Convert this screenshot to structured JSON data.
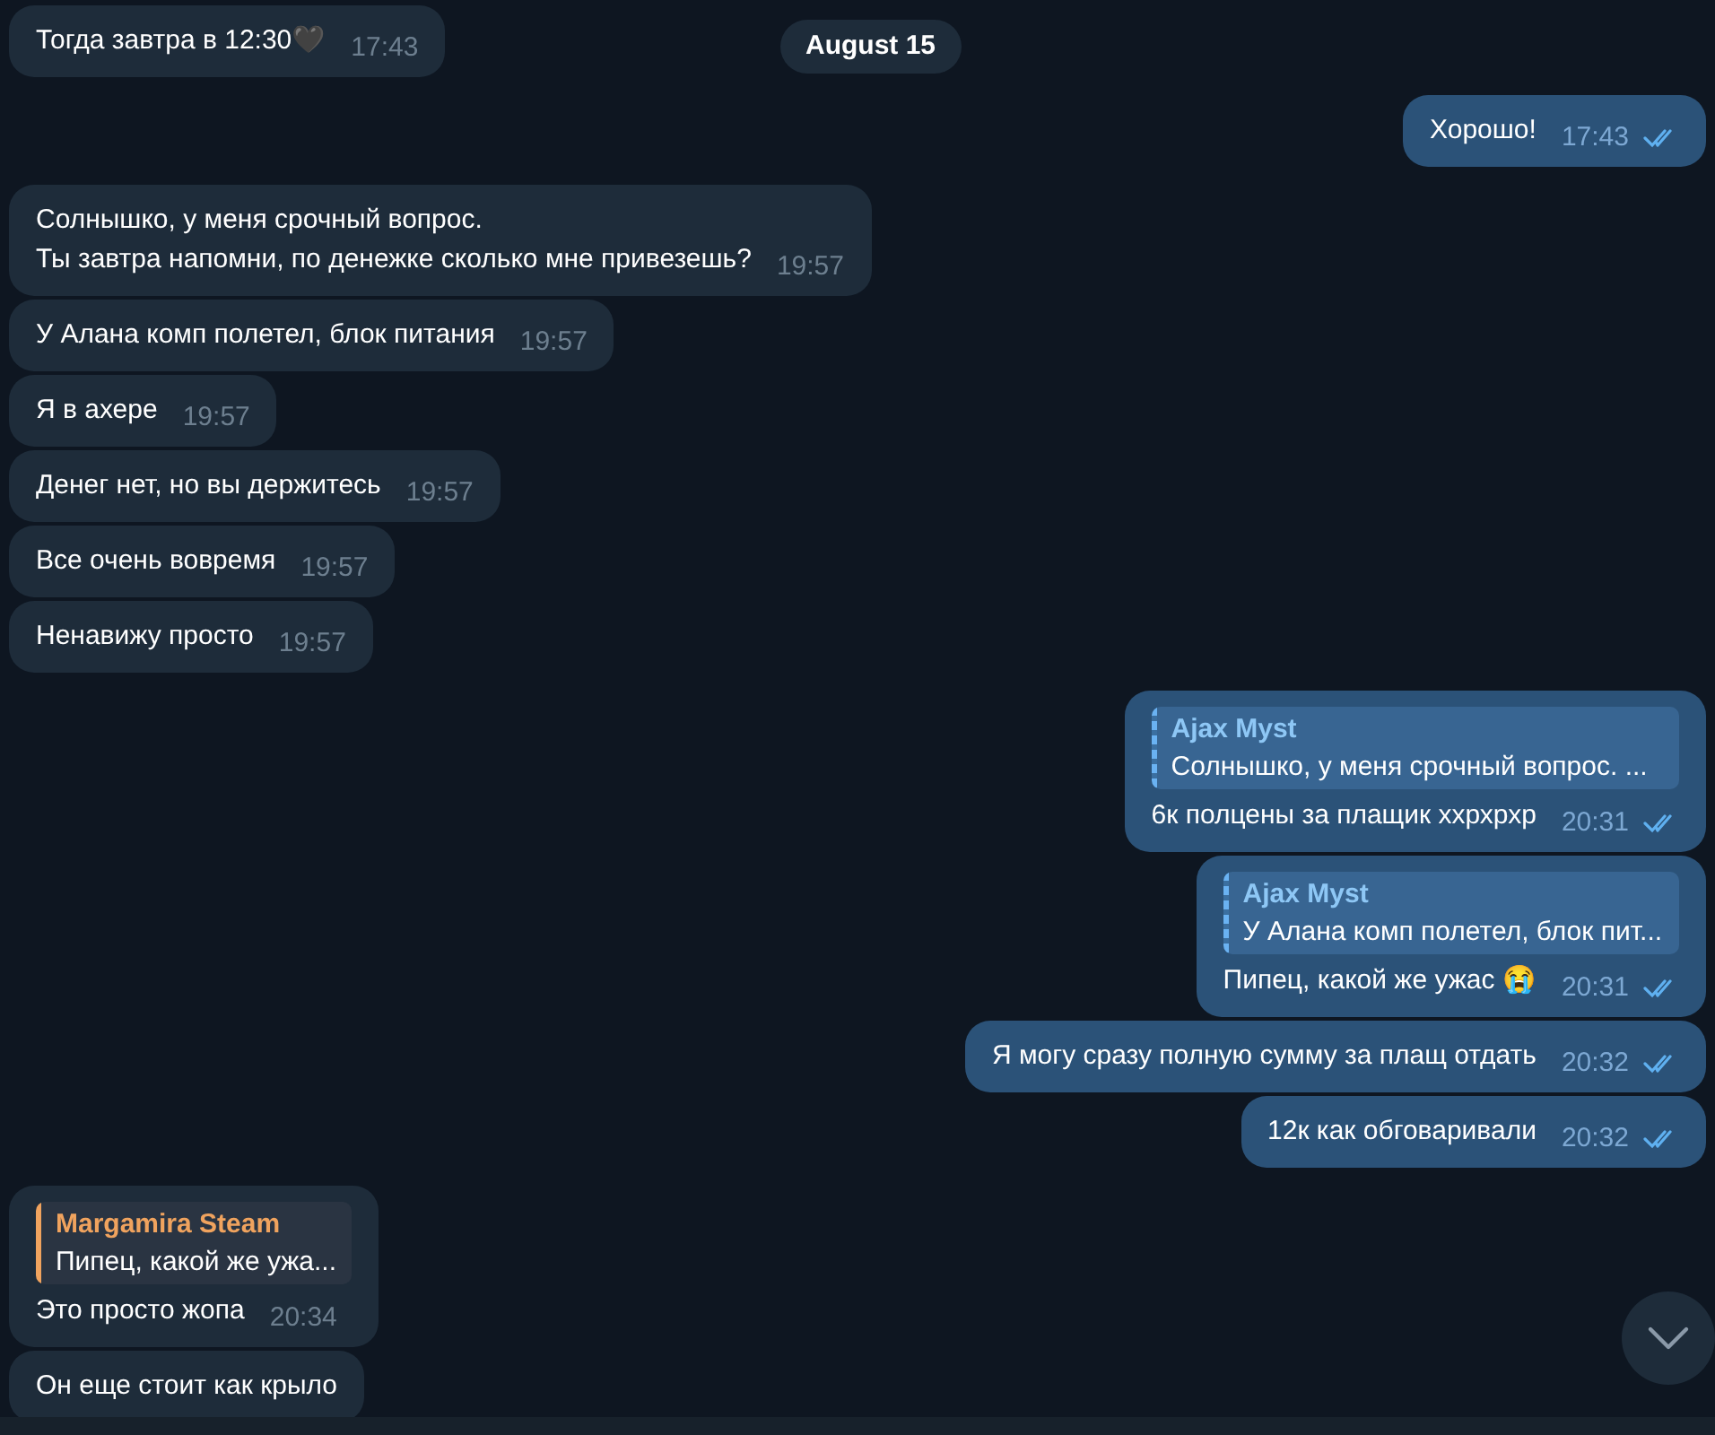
{
  "date_badge": "August 15",
  "messages": [
    {
      "kind": "incoming",
      "text": "Тогда завтра в 12:30🖤",
      "time": "17:43"
    },
    {
      "kind": "outgoing",
      "text": "Хорошо!",
      "time": "17:43",
      "read": true
    },
    {
      "kind": "incoming",
      "text": "Солнышко, у меня срочный вопрос.\nТы завтра напомни, по денежке сколько мне привезешь?",
      "time": "19:57"
    },
    {
      "kind": "incoming",
      "text": "У Алана комп полетел, блок питания",
      "time": "19:57"
    },
    {
      "kind": "incoming",
      "text": "Я в ахере",
      "time": "19:57"
    },
    {
      "kind": "incoming",
      "text": "Денег нет, но вы держитесь",
      "time": "19:57"
    },
    {
      "kind": "incoming",
      "text": "Все очень вовремя",
      "time": "19:57"
    },
    {
      "kind": "incoming",
      "text": "Ненавижу просто",
      "time": "19:57"
    },
    {
      "kind": "outgoing",
      "reply": {
        "author": "Ajax Myst",
        "text": "Солнышко, у меня срочный вопрос. ..."
      },
      "text": "6к полцены за плащик ххрхрхр",
      "time": "20:31",
      "read": true
    },
    {
      "kind": "outgoing",
      "reply": {
        "author": "Ajax Myst",
        "text": "У Алана комп полетел, блок пит..."
      },
      "text": "Пипец, какой же ужас 😭",
      "time": "20:31",
      "read": true
    },
    {
      "kind": "outgoing",
      "text": "Я могу сразу полную сумму за плащ отдать",
      "time": "20:32",
      "read": true
    },
    {
      "kind": "outgoing",
      "text": "12к как обговаривали",
      "time": "20:32",
      "read": true
    },
    {
      "kind": "incoming",
      "reply": {
        "author": "Margamira Steam",
        "text": "Пипец, какой же ужа..."
      },
      "text": "Это просто жопа",
      "time": "20:34"
    },
    {
      "kind": "incoming",
      "text": "Он еще стоит как крыло"
    }
  ]
}
